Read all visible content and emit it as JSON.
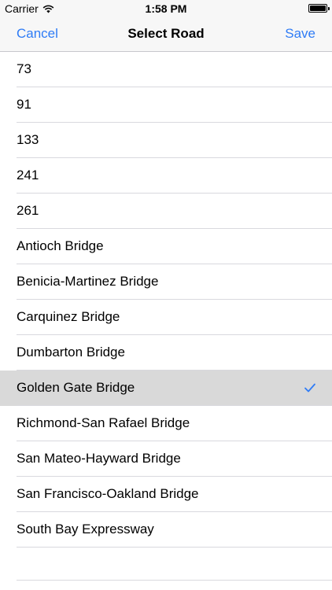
{
  "status_bar": {
    "carrier": "Carrier",
    "time": "1:58 PM",
    "wifi_icon": "wifi-icon",
    "battery_icon": "battery-icon",
    "battery_level": 1.0
  },
  "nav": {
    "cancel_label": "Cancel",
    "title": "Select Road",
    "save_label": "Save"
  },
  "accent_color": "#2f7cf6",
  "selected_index": 9,
  "roads": [
    {
      "label": "73"
    },
    {
      "label": "91"
    },
    {
      "label": "133"
    },
    {
      "label": "241"
    },
    {
      "label": "261"
    },
    {
      "label": "Antioch Bridge"
    },
    {
      "label": "Benicia-Martinez Bridge"
    },
    {
      "label": "Carquinez Bridge"
    },
    {
      "label": "Dumbarton Bridge"
    },
    {
      "label": "Golden Gate Bridge",
      "selected": true
    },
    {
      "label": "Richmond-San Rafael Bridge"
    },
    {
      "label": "San Mateo-Hayward Bridge"
    },
    {
      "label": "San Francisco-Oakland Bridge"
    },
    {
      "label": "South Bay Expressway"
    }
  ]
}
